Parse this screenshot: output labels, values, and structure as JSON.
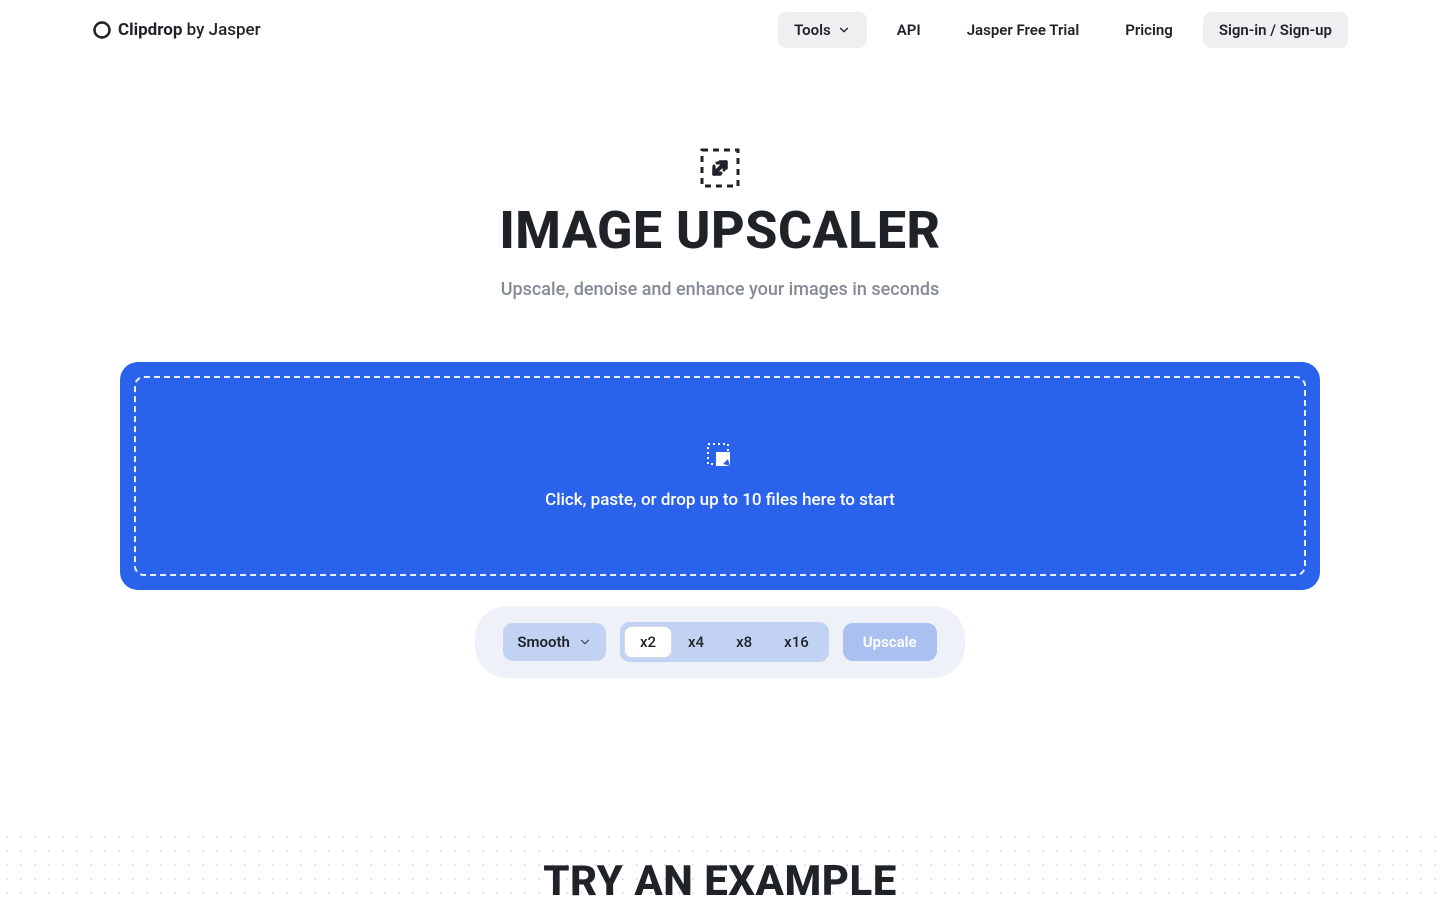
{
  "header": {
    "logo_strong": "Clipdrop",
    "logo_light": " by Jasper"
  },
  "nav": {
    "tools": "Tools",
    "api": "API",
    "trial": "Jasper Free Trial",
    "pricing": "Pricing",
    "signin": "Sign-in / Sign-up"
  },
  "hero": {
    "title": "IMAGE UPSCALER",
    "subtitle": "Upscale, denoise and enhance your images in seconds"
  },
  "dropzone": {
    "text": "Click, paste, or drop up to 10 files here to start"
  },
  "controls": {
    "mode_label": "Smooth",
    "scale_options": [
      "x2",
      "x4",
      "x8",
      "x16"
    ],
    "selected_scale": "x2",
    "action_label": "Upscale"
  },
  "section2": {
    "title": "TRY AN EXAMPLE"
  }
}
